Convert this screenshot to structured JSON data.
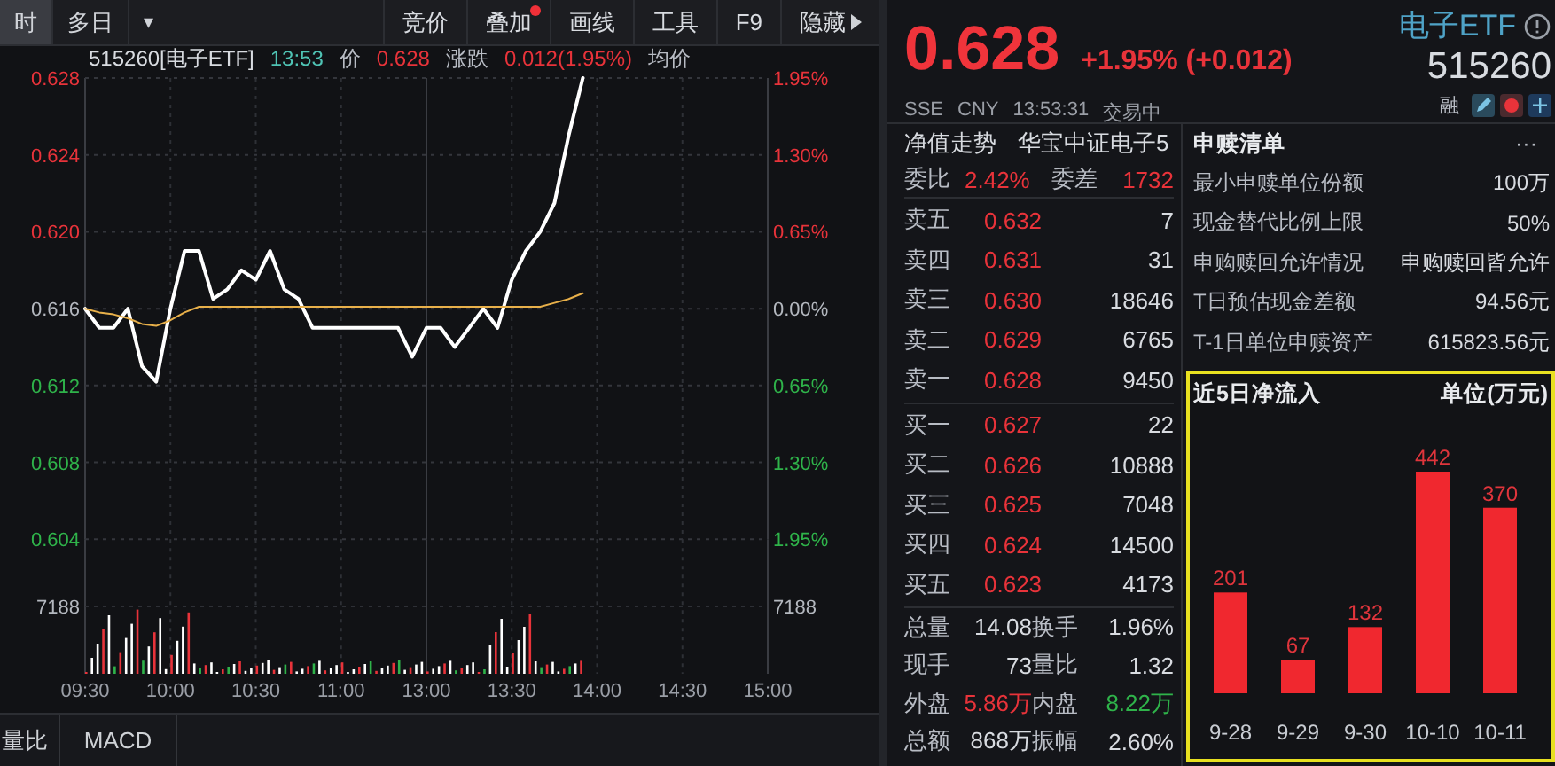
{
  "toolbar": {
    "tabs": [
      {
        "label": "时",
        "selected": true
      },
      {
        "label": "多日",
        "selected": false
      }
    ],
    "dropdown": "▾",
    "buttons": [
      {
        "label": "竞价",
        "badge": false
      },
      {
        "label": "叠加",
        "badge": true
      },
      {
        "label": "画线",
        "badge": false
      },
      {
        "label": "工具",
        "badge": false
      },
      {
        "label": "F9",
        "badge": false
      },
      {
        "label": "隐藏",
        "badge": false
      }
    ]
  },
  "quote_line": {
    "code": "515260[电子ETF]",
    "time": "13:53",
    "price_label": "价",
    "price": "0.628",
    "change_label": "涨跌",
    "change": "0.012(1.95%)",
    "avg_label": "均价"
  },
  "intraday_chart": {
    "chart_data": {
      "type": "line",
      "categories": [
        "09:30",
        null,
        null,
        null,
        null,
        null,
        "10:00",
        null,
        null,
        null,
        null,
        null,
        "10:30",
        null,
        null,
        null,
        null,
        null,
        "11:00",
        null,
        null,
        null,
        null,
        null,
        "13:00",
        null,
        null,
        null,
        null,
        null,
        "13:30",
        null,
        null,
        null,
        null,
        null,
        "14:00",
        null,
        null,
        null,
        null,
        null,
        "14:30",
        null,
        null,
        null,
        null,
        null,
        "15:00"
      ],
      "series": [
        {
          "color": "#ffffff",
          "values": [
            0.616,
            0.615,
            0.615,
            0.616,
            0.613,
            0.6122,
            0.616,
            0.619,
            0.619,
            0.6165,
            0.617,
            0.618,
            0.6175,
            0.619,
            0.617,
            0.6165,
            0.615,
            0.615,
            0.615,
            0.615,
            0.615,
            0.615,
            0.615,
            0.6135,
            0.615,
            0.615,
            0.614,
            0.615,
            0.616,
            0.615,
            0.6175,
            0.619,
            0.62,
            0.6215,
            0.625,
            0.628,
            null,
            null,
            null,
            null,
            null,
            null,
            null,
            null,
            null,
            null,
            null,
            null,
            null
          ]
        },
        {
          "color": "#e8b04a",
          "values": [
            0.616,
            0.6158,
            0.6157,
            0.6155,
            0.6152,
            0.6151,
            0.6154,
            0.6158,
            0.6161,
            0.6161,
            0.6161,
            0.6161,
            0.6161,
            0.6161,
            0.6161,
            0.6161,
            0.6161,
            0.6161,
            0.6161,
            0.6161,
            0.6161,
            0.6161,
            0.6161,
            0.6161,
            0.6161,
            0.6161,
            0.6161,
            0.6161,
            0.6161,
            0.6161,
            0.6161,
            0.6161,
            0.6161,
            0.6163,
            0.6165,
            0.6168,
            null,
            null,
            null,
            null,
            null,
            null,
            null,
            null,
            null,
            null,
            null,
            null,
            null
          ]
        }
      ],
      "ylim": [
        0.597,
        0.628
      ],
      "grid": true,
      "yticks": [
        {
          "value": 0.628,
          "label": "0.628"
        },
        {
          "value": 0.624,
          "label": "0.624"
        },
        {
          "value": 0.62,
          "label": "0.620"
        },
        {
          "value": 0.616,
          "label": "0.616"
        },
        {
          "value": 0.612,
          "label": "0.612"
        },
        {
          "value": 0.608,
          "label": "0.608"
        },
        {
          "value": 0.604,
          "label": "0.604"
        }
      ]
    },
    "right_ticks": [
      "1.95%",
      "1.30%",
      "0.65%",
      "0.00%",
      "0.65%",
      "1.30%",
      "1.95%"
    ],
    "volume_ticks": [
      "7188",
      "7188"
    ]
  },
  "bottom_tabs": [
    {
      "label": "量比",
      "selected": false
    },
    {
      "label": "MACD",
      "selected": false
    }
  ],
  "header": {
    "price": "0.628",
    "change": "+1.95% (+0.012)",
    "name": "电子ETF",
    "code": "515260",
    "margin_label": "融",
    "exchange": "SSE",
    "currency": "CNY",
    "time": "13:53:31",
    "status": "交易中"
  },
  "fund_line": {
    "nav_link": "净值走势",
    "index_name": "华宝中证电子5"
  },
  "order_ratio": {
    "label": "委比",
    "value": "2.42%",
    "diff_label": "委差",
    "diff": "1732"
  },
  "asks": [
    {
      "label": "卖五",
      "price": "0.632",
      "volume": "7"
    },
    {
      "label": "卖四",
      "price": "0.631",
      "volume": "31"
    },
    {
      "label": "卖三",
      "price": "0.630",
      "volume": "18646"
    },
    {
      "label": "卖二",
      "price": "0.629",
      "volume": "6765"
    },
    {
      "label": "卖一",
      "price": "0.628",
      "volume": "9450"
    }
  ],
  "bids": [
    {
      "label": "买一",
      "price": "0.627",
      "volume": "22"
    },
    {
      "label": "买二",
      "price": "0.626",
      "volume": "10888"
    },
    {
      "label": "买三",
      "price": "0.625",
      "volume": "7048"
    },
    {
      "label": "买四",
      "price": "0.624",
      "volume": "14500"
    },
    {
      "label": "买五",
      "price": "0.623",
      "volume": "4173"
    }
  ],
  "stats": [
    [
      {
        "label": "总量",
        "value": "14.08",
        "color": "#d8dbe0"
      },
      {
        "label": "换手",
        "value": "1.96%",
        "color": "#d8dbe0"
      }
    ],
    [
      {
        "label": "现手",
        "value": "73",
        "color": "#d8dbe0"
      },
      {
        "label": "量比",
        "value": "1.32",
        "color": "#d8dbe0"
      }
    ],
    [
      {
        "label": "外盘",
        "value": "5.86万",
        "color": "#e8333a"
      },
      {
        "label": "内盘",
        "value": "8.22万",
        "color": "#2fb34a"
      }
    ],
    [
      {
        "label": "总额",
        "value": "868万",
        "color": "#d8dbe0"
      },
      {
        "label": "振幅",
        "value": "2.60%",
        "color": "#d8dbe0"
      }
    ]
  ],
  "creation_redemption": {
    "title": "申赎清单",
    "more": "···",
    "rows": [
      {
        "label": "最小申赎单位份额",
        "value": "100万"
      },
      {
        "label": "现金替代比例上限",
        "value": "50%"
      },
      {
        "label": "申购赎回允许情况",
        "value": "申购赎回皆允许"
      },
      {
        "label": "T日预估现金差额",
        "value": "94.56元"
      },
      {
        "label": "T-1日单位申赎资产",
        "value": "615823.56元"
      }
    ]
  },
  "net_inflow": {
    "unit": "单位(万元)",
    "chart_data": {
      "type": "bar",
      "title": "近5日净流入",
      "categories": [
        "9-28",
        "9-29",
        "9-30",
        "10-10",
        "10-11"
      ],
      "series": [
        {
          "color": "#f0282f",
          "values": [
            201,
            67,
            132,
            442,
            370
          ]
        }
      ],
      "data_labels": true
    }
  }
}
